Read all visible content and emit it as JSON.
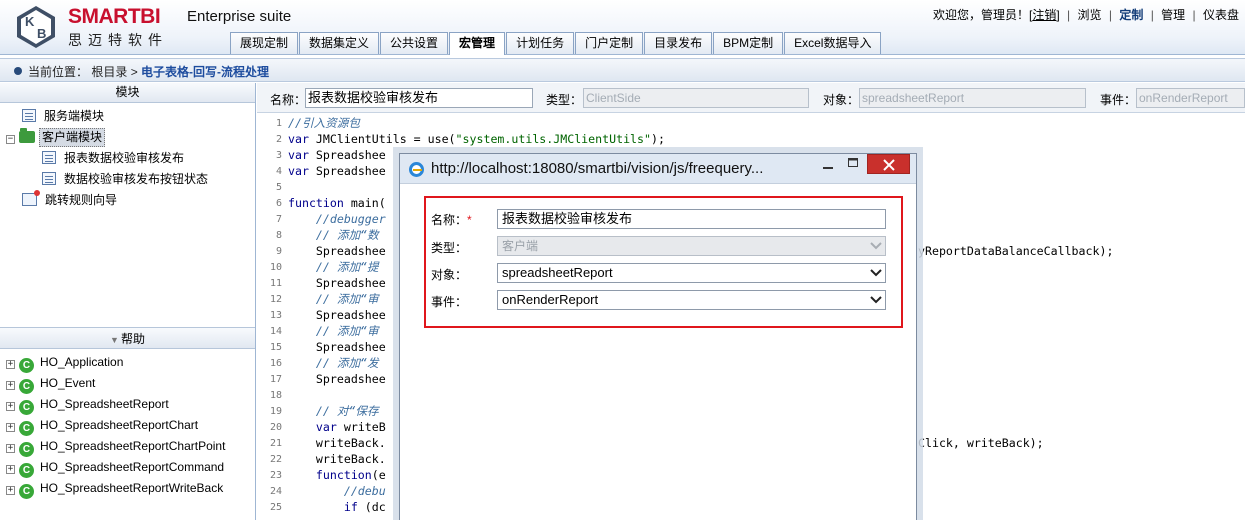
{
  "header": {
    "brand": "SMARTBI",
    "brand_cn": "思迈特软件",
    "product": "Enterprise suite",
    "welcome": "欢迎您，管理员！[",
    "logout": "注销",
    "welcome_end": "]",
    "links": [
      "浏览",
      "定制",
      "管理",
      "仪表盘"
    ]
  },
  "tabs": [
    "展现定制",
    "数据集定义",
    "公共设置",
    "宏管理",
    "计划任务",
    "门户定制",
    "目录发布",
    "BPM定制",
    "Excel数据导入"
  ],
  "active_tab": "宏管理",
  "breadcrumb": {
    "prefix": "当前位置：",
    "root": "根目录 >",
    "current": "电子表格-回写-流程处理"
  },
  "module_tree": {
    "title": "模块",
    "items": [
      {
        "label": "服务端模块",
        "icon": "page-icon"
      },
      {
        "label": "客户端模块",
        "icon": "folder-icon",
        "selected": true
      },
      {
        "label": "报表数据校验审核发布",
        "icon": "page-icon"
      },
      {
        "label": "数据校验审核发布按钮状态",
        "icon": "page-icon"
      },
      {
        "label": "跳转规则向导",
        "icon": "gear-icon"
      }
    ]
  },
  "help": {
    "title": "帮助",
    "items": [
      "HO_Application",
      "HO_Event",
      "HO_SpreadsheetReport",
      "HO_SpreadsheetReportChart",
      "HO_SpreadsheetReportChartPoint",
      "HO_SpreadsheetReportCommand",
      "HO_SpreadsheetReportWriteBack"
    ]
  },
  "form": {
    "name_label": "名称：",
    "name_value": "报表数据校验审核发布",
    "type_label": "类型：",
    "type_value": "ClientSide",
    "object_label": "对象：",
    "object_value": "spreadsheetReport",
    "event_label": "事件：",
    "event_value": "onRenderReport"
  },
  "code": {
    "line_numbers": [
      "1",
      "2",
      "3",
      "4",
      "5",
      "6",
      "7",
      "8",
      "9",
      "10",
      "11",
      "12",
      "13",
      "14",
      "15",
      "16",
      "17",
      "18",
      "19",
      "20",
      "21",
      "22",
      "23",
      "24",
      "25"
    ],
    "l1": "//引入资源包",
    "l2_kw": "var",
    "l2_mid": " JMClientUtils = use(",
    "l2_str": "\"system.utils.JMClientUtils\"",
    "l2_end": ");",
    "l3_kw": "var",
    "l3_rest": " Spreadshee",
    "l4_kw": "var",
    "l4_rest": " Spreadshee",
    "l6_kw": "function",
    "l6_rest": " main(",
    "l7": "    //debugger",
    "l8": "    // 添加“数",
    "l9": "    Spreadshee",
    "l9_tail": "yReportDataBalanceCallback);",
    "l10": "    // 添加“提",
    "l11": "    Spreadshee",
    "l12": "    // 添加“审",
    "l13": "    Spreadshee",
    "l14": "    // 添加“审",
    "l15": "    Spreadshee",
    "l16": "    // 添加“发",
    "l17": "    Spreadshee",
    "l19": "    // 对“保存",
    "l20_kw": "    var",
    "l20_rest": " writeB",
    "l21": "    writeBack.",
    "l21_tail": "Click, writeBack);",
    "l22": "    writeBack.",
    "l23_kw": "    function",
    "l23_rest": "(e",
    "l24": "        //debu",
    "l25_kw": "        if",
    "l25_rest": " (dc"
  },
  "dialog": {
    "title": "http://localhost:18080/smartbi/vision/js/freequery...",
    "min": "□",
    "max": "□",
    "close": "✕",
    "name_label": "名称：",
    "req": "*",
    "name_value": "报表数据校验审核发布",
    "type_label": "类型：",
    "type_value": "客户端",
    "object_label": "对象：",
    "object_value": "spreadsheetReport",
    "event_label": "事件：",
    "event_value": "onRenderReport"
  }
}
